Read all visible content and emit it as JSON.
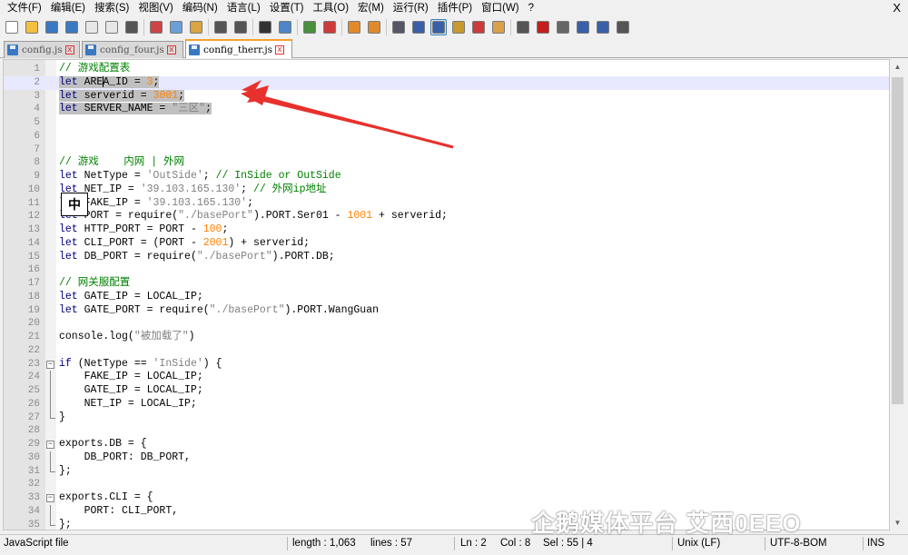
{
  "menu": [
    "文件(F)",
    "编辑(E)",
    "搜索(S)",
    "视图(V)",
    "编码(N)",
    "语言(L)",
    "设置(T)",
    "工具(O)",
    "宏(M)",
    "运行(R)",
    "插件(P)",
    "窗口(W)",
    "?"
  ],
  "window_close": "X",
  "tabs": [
    {
      "label": "config.js",
      "close": "x"
    },
    {
      "label": "config_four.js",
      "close": "x"
    },
    {
      "label": "config_therr.js",
      "close": "x"
    }
  ],
  "toolbar_icons": [
    "new-file-icon",
    "open-file-icon",
    "save-icon",
    "save-all-icon",
    "close-icon",
    "close-all-icon",
    "print-icon",
    "cut-icon",
    "copy-icon",
    "paste-icon",
    "undo-icon",
    "redo-icon",
    "find-icon",
    "replace-icon",
    "zoom-in-icon",
    "zoom-out-icon",
    "sync-v-icon",
    "sync-h-icon",
    "word-wrap-icon",
    "show-all-chars-icon",
    "indent-guide-icon",
    "doc-map-icon",
    "function-list-icon",
    "folder-workspace-icon",
    "monitor-icon",
    "record-macro-icon",
    "stop-record-icon",
    "play-macro-icon",
    "run-macro-multiple-icon",
    "save-macro-icon"
  ],
  "ime_char": "中",
  "editor": {
    "lines": [
      {
        "n": "1",
        "html": "<span class=\"cmt\">// 游戏配置表</span>"
      },
      {
        "n": "2",
        "html": "<span class=\"sel\"><span class=\"kw\">let</span> ARE<span class=\"caret\"></span>A_ID = <span class=\"num\">3</span>;</span>"
      },
      {
        "n": "3",
        "html": "<span class=\"sel\"><span class=\"kw\">let</span> serverid = <span class=\"num\">3001</span>;</span>"
      },
      {
        "n": "4",
        "html": "<span class=\"sel\"><span class=\"kw\">let</span> SERVER_NAME = <span class=\"str\">\"三区\"</span>;</span>"
      },
      {
        "n": "5",
        "html": ""
      },
      {
        "n": "6",
        "html": ""
      },
      {
        "n": "7",
        "html": ""
      },
      {
        "n": "8",
        "html": "<span class=\"cmt\">// 游戏    内网 | 外网</span>"
      },
      {
        "n": "9",
        "html": "<span class=\"kw\">let</span> NetType = <span class=\"str\">'OutSide'</span>; <span class=\"cmt\">// InSide or OutSide</span>"
      },
      {
        "n": "10",
        "html": "<span class=\"kw\">let</span> NET_IP = <span class=\"str\">'39.103.165.130'</span>; <span class=\"cmt\">// 外网ip地址</span>"
      },
      {
        "n": "11",
        "html": "<span class=\"kw\">let</span> FAKE_IP = <span class=\"str\">'39.103.165.130'</span>;"
      },
      {
        "n": "12",
        "html": "<span class=\"kw\">let</span> PORT = require(<span class=\"str\">\"./basePort\"</span>).PORT.Ser01 - <span class=\"num\">1001</span> + serverid;"
      },
      {
        "n": "13",
        "html": "<span class=\"kw\">let</span> HTTP_PORT = PORT - <span class=\"num\">100</span>;"
      },
      {
        "n": "14",
        "html": "<span class=\"kw\">let</span> CLI_PORT = (PORT - <span class=\"num\">2001</span>) + serverid;"
      },
      {
        "n": "15",
        "html": "<span class=\"kw\">let</span> DB_PORT = require(<span class=\"str\">\"./basePort\"</span>).PORT.DB;"
      },
      {
        "n": "16",
        "html": ""
      },
      {
        "n": "17",
        "html": "<span class=\"cmt\">// 网关服配置</span>"
      },
      {
        "n": "18",
        "html": "<span class=\"kw\">let</span> GATE_IP = LOCAL_IP;"
      },
      {
        "n": "19",
        "html": "<span class=\"kw\">let</span> GATE_PORT = require(<span class=\"str\">\"./basePort\"</span>).PORT.WangGuan"
      },
      {
        "n": "20",
        "html": ""
      },
      {
        "n": "21",
        "html": "console.log(<span class=\"str\">\"被加载了\"</span>)"
      },
      {
        "n": "22",
        "html": ""
      },
      {
        "n": "23",
        "html": "<span class=\"kw\">if</span> (NetType == <span class=\"str\">'InSide'</span>) {"
      },
      {
        "n": "24",
        "html": "    FAKE_IP = LOCAL_IP;"
      },
      {
        "n": "25",
        "html": "    GATE_IP = LOCAL_IP;"
      },
      {
        "n": "26",
        "html": "    NET_IP = LOCAL_IP;"
      },
      {
        "n": "27",
        "html": "}"
      },
      {
        "n": "28",
        "html": ""
      },
      {
        "n": "29",
        "html": "exports.DB = {"
      },
      {
        "n": "30",
        "html": "    DB_PORT: DB_PORT,"
      },
      {
        "n": "31",
        "html": "};"
      },
      {
        "n": "32",
        "html": ""
      },
      {
        "n": "33",
        "html": "exports.CLI = {"
      },
      {
        "n": "34",
        "html": "    PORT: CLI_PORT,"
      },
      {
        "n": "35",
        "html": "};"
      }
    ]
  },
  "status": {
    "filetype": "JavaScript file",
    "length": "length : 1,063",
    "lines": "lines : 57",
    "ln": "Ln : 2",
    "col": "Col : 8",
    "sel": "Sel : 55 | 4",
    "eol": "Unix (LF)",
    "encoding": "UTF-8-BOM",
    "mode": "INS"
  },
  "watermark": "企鹅媒体平台  艾西0EEO"
}
